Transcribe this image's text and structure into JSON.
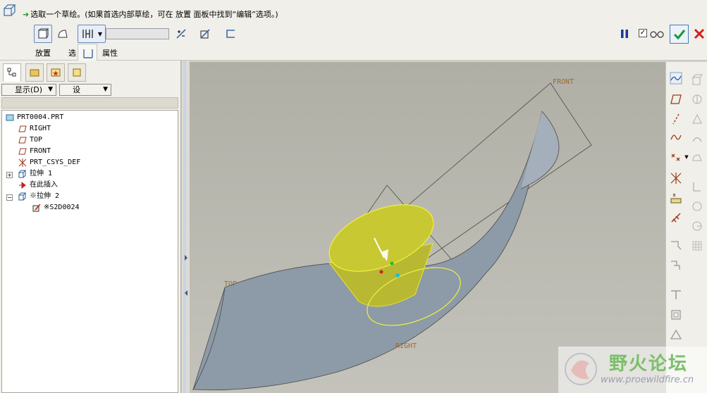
{
  "dashboard": {
    "prompt": "选取一个草绘。(如果首选内部草绘，可在 放置 面板中找到“编辑”选项。)",
    "depth_value": "",
    "tabs": [
      {
        "label": "放置"
      },
      {
        "label": "选"
      },
      {
        "label": "属性"
      }
    ],
    "preview_checked": "✓"
  },
  "navigator": {
    "show_button": "显示(D)",
    "settings_button": "设",
    "tree": {
      "root": "PRT0004.PRT",
      "items": [
        {
          "label": "RIGHT",
          "icon": "datum-plane-icon"
        },
        {
          "label": "TOP",
          "icon": "datum-plane-icon"
        },
        {
          "label": "FRONT",
          "icon": "datum-plane-icon"
        },
        {
          "label": "PRT_CSYS_DEF",
          "icon": "csys-icon"
        },
        {
          "label": "拉伸 1",
          "icon": "extrude-icon"
        },
        {
          "label": "在此插入",
          "icon": "insert-here-icon"
        },
        {
          "label": "※拉伸 2",
          "icon": "extrude-icon"
        },
        {
          "label": "※S2D0024",
          "icon": "sketch-icon"
        }
      ]
    }
  },
  "viewport": {
    "datum_labels": {
      "front": "FRONT",
      "top": "TOP",
      "right": "RIGHT"
    }
  },
  "watermark": {
    "title": "野火论坛",
    "url": "www.proewildfire.cn"
  },
  "colors": {
    "accent": "#4a78b8",
    "ok_green": "#1a9a2a",
    "cancel_red": "#d42020",
    "surface": "#8d9aa8",
    "preview_yellow": "#c8c832"
  }
}
